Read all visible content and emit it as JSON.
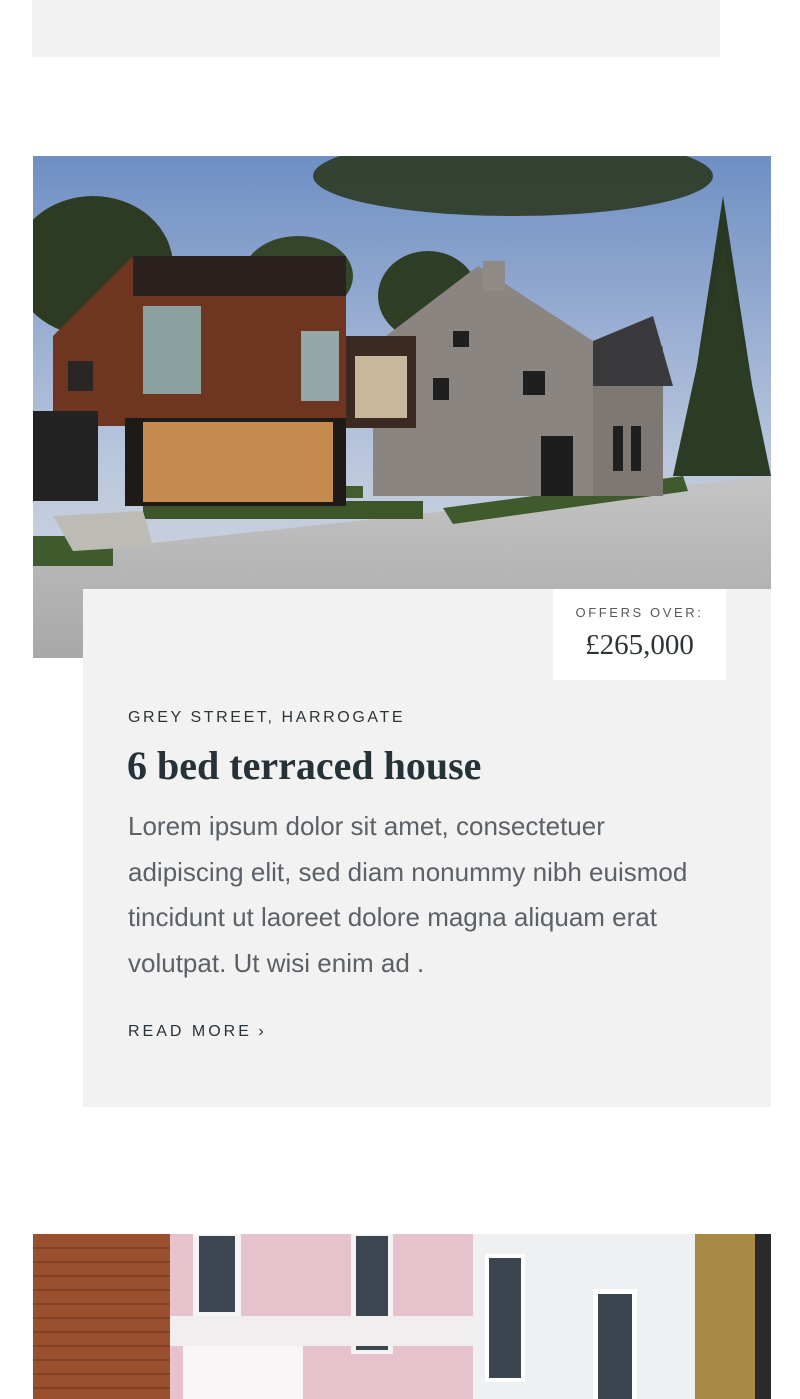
{
  "listing": {
    "price_label": "OFFERS OVER:",
    "price": "£265,000",
    "address": "GREY STREET, HARROGATE",
    "title": "6 bed terraced house",
    "description": "Lorem ipsum dolor sit amet, consectetuer adipiscing elit, sed diam nonummy nibh euismod tincidunt ut laoreet dolore magna aliquam erat volutpat. Ut wisi enim ad .",
    "read_more": "READ MORE",
    "read_more_icon": "chevron-right-icon"
  },
  "colors": {
    "card_background": "#f2f2f2",
    "text_dark": "#263238",
    "text_body": "#5b6166"
  }
}
